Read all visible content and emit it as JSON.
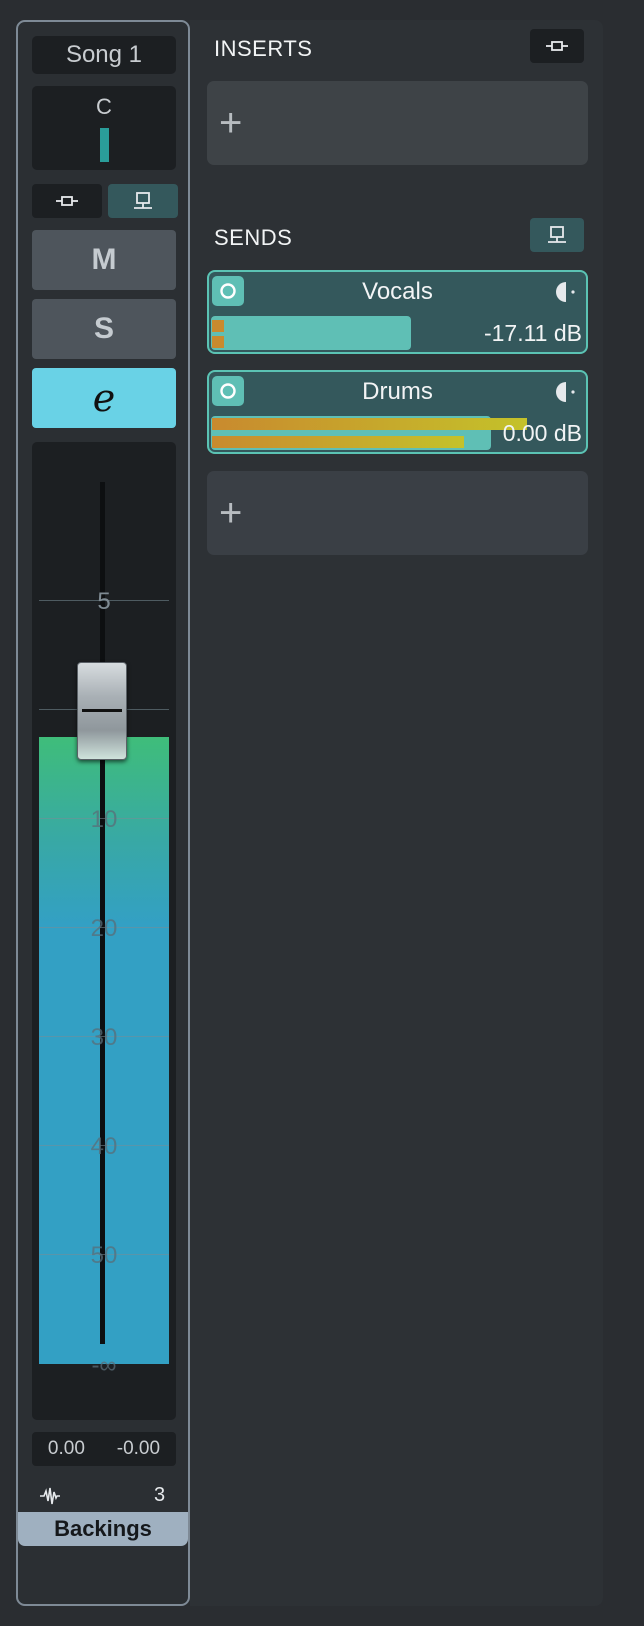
{
  "channel": {
    "song_label": "Song 1",
    "pan_label": "C",
    "mute_label": "M",
    "solo_label": "S",
    "edit_label": "e",
    "fader_scale": [
      "5",
      "0",
      "10",
      "20",
      "30",
      "40",
      "50",
      "-∞"
    ],
    "gain_value": "0.00",
    "pan_value": "-0.00",
    "track_number": "3",
    "track_name": "Backings",
    "colors": {
      "meter_top": "#3fbd7a",
      "meter_main": "#33a0c4",
      "edit_button": "#69d2e6",
      "name_bar": "#9fb0c0"
    }
  },
  "inserts": {
    "title": "INSERTS",
    "add_label": "+"
  },
  "sends": {
    "title": "SENDS",
    "items": [
      {
        "name": "Vocals",
        "level": "-17.11 dB",
        "level_fraction": 0.52
      },
      {
        "name": "Drums",
        "level": "0.00 dB",
        "level_fraction": 0.73
      }
    ],
    "add_label": "+",
    "colors": {
      "send_bg": "#34585c",
      "send_border": "#5bc3b4",
      "send_level": "#5fbfb5"
    }
  }
}
